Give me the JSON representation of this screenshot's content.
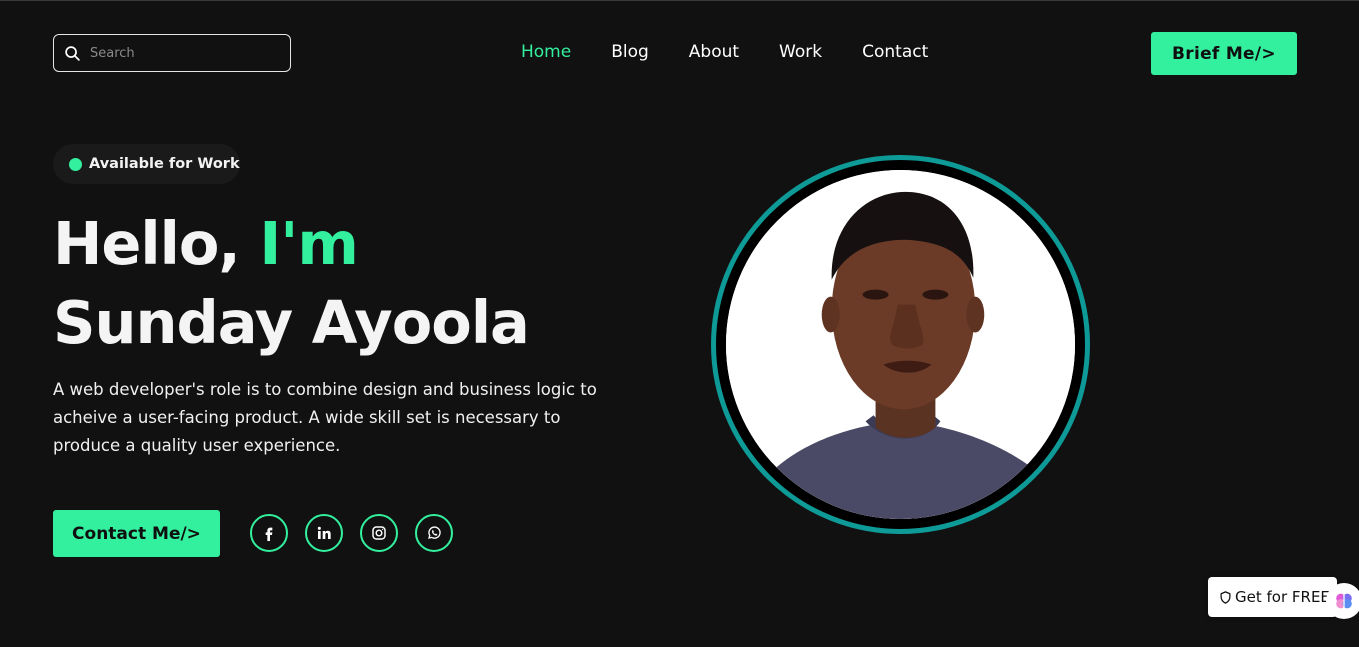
{
  "header": {
    "search": {
      "placeholder": "Search",
      "icon": "search-icon"
    },
    "nav": [
      {
        "label": "Home",
        "active": true
      },
      {
        "label": "Blog",
        "active": false
      },
      {
        "label": "About",
        "active": false
      },
      {
        "label": "Work",
        "active": false
      },
      {
        "label": "Contact",
        "active": false
      }
    ],
    "cta_label": "Brief Me/>"
  },
  "hero": {
    "badge": "Available for Work",
    "headline_line1": "Hello, ",
    "headline_accent": "I'm",
    "headline_line2": "Sunday Ayoola",
    "description": "A web developer's role is to combine design and business logic to acheive a user-facing product. A wide skill set is necessary to produce a quality user experience.",
    "contact_label": "Contact Me/>",
    "socials": [
      "facebook-icon",
      "linkedin-icon",
      "instagram-icon",
      "whatsapp-icon"
    ]
  },
  "widget": {
    "label": "Get for FREE",
    "icon": "shield-icon"
  },
  "colors": {
    "background": "#111111",
    "accent": "#33f09e",
    "ring": "#0e9a97"
  }
}
